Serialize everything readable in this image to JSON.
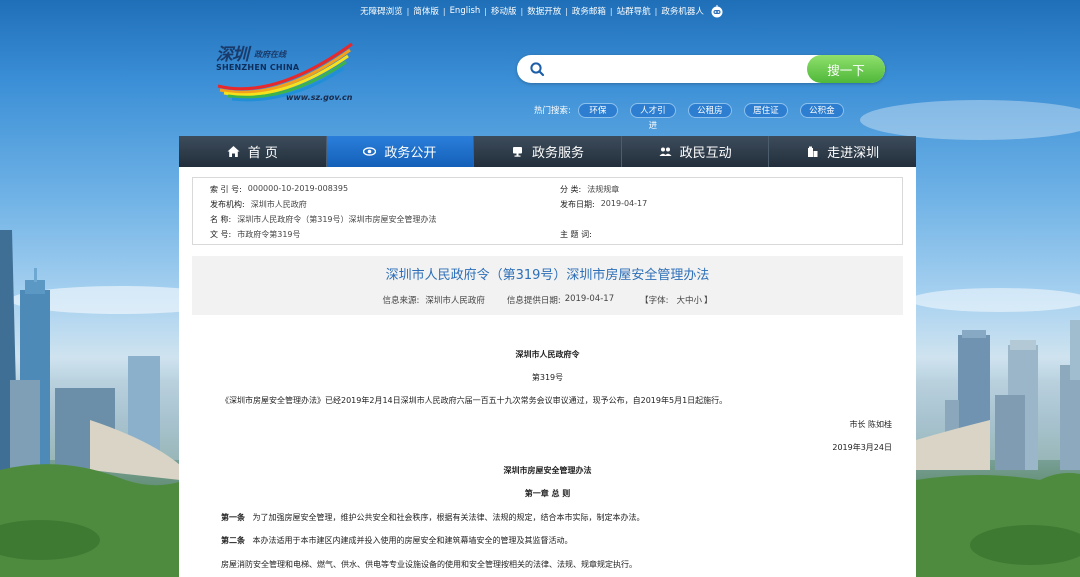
{
  "topbar": {
    "links": [
      "无障碍浏览",
      "简体版",
      "English",
      "移动版",
      "数据开放",
      "政务邮箱",
      "站群导航",
      "政务机器人"
    ]
  },
  "logo": {
    "cn_main": "深圳",
    "cn_sub": "政府在线",
    "en": "SHENZHEN CHINA",
    "url": "www.sz.gov.cn"
  },
  "search": {
    "placeholder": "",
    "button_label": "搜一下"
  },
  "hot_search": {
    "label": "热门搜索:",
    "tags": [
      "环保",
      "人才引进",
      "公租房",
      "居住证",
      "公积金"
    ]
  },
  "nav": {
    "items": [
      {
        "label": "首 页",
        "icon": "home-icon"
      },
      {
        "label": "政务公开",
        "icon": "eye-icon"
      },
      {
        "label": "政务服务",
        "icon": "monitor-icon"
      },
      {
        "label": "政民互动",
        "icon": "people-icon"
      },
      {
        "label": "走进深圳",
        "icon": "building-icon"
      }
    ],
    "active_index": 1
  },
  "meta": {
    "index_no_label": "索 引 号:",
    "index_no": "000000-10-2019-008395",
    "category_label": "分    类:",
    "category": "法规规章",
    "publisher_label": "发布机构:",
    "publisher": "深圳市人民政府",
    "pub_date_label": "发布日期:",
    "pub_date": "2019-04-17",
    "name_label": "名    称:",
    "name": "深圳市人民政府令（第319号）深圳市房屋安全管理办法",
    "doc_no_label": "文    号:",
    "doc_no": "市政府令第319号",
    "keywords_label": "主 题 词:",
    "keywords": ""
  },
  "article": {
    "title": "深圳市人民政府令（第319号）深圳市房屋安全管理办法",
    "source_label": "信息来源:",
    "source": "深圳市人民政府",
    "date_label": "信息提供日期:",
    "date": "2019-04-17",
    "font_label": "【字体:",
    "font_large": "大",
    "font_medium": "中",
    "font_small": "小",
    "font_close": "】"
  },
  "body": {
    "heading1": "深圳市人民政府令",
    "heading2": "第319号",
    "intro": "《深圳市房屋安全管理办法》已经2019年2月14日深圳市人民政府六届一百五十九次常务会议审议通过，现予公布，自2019年5月1日起施行。",
    "signer": "市长    陈如桂",
    "sign_date": "2019年3月24日",
    "doc_title": "深圳市房屋安全管理办法",
    "chapter1": "第一章  总    则",
    "art1_label": "第一条",
    "art1": "为了加强房屋安全管理，维护公共安全和社会秩序，根据有关法律、法规的规定，结合本市实际，制定本办法。",
    "art2_label": "第二条",
    "art2": "本办法适用于本市建区内建成并投入使用的房屋安全和建筑幕墙安全的管理及其监督活动。",
    "art2_cont": "房屋消防安全管理和电梯、燃气、供水、供电等专业设施设备的使用和安全管理按相关的法律、法规、规章规定执行。"
  },
  "colors": {
    "nav_active": "#1a6fcc",
    "title_blue": "#2d6fb8",
    "search_button": "#5cc041"
  }
}
